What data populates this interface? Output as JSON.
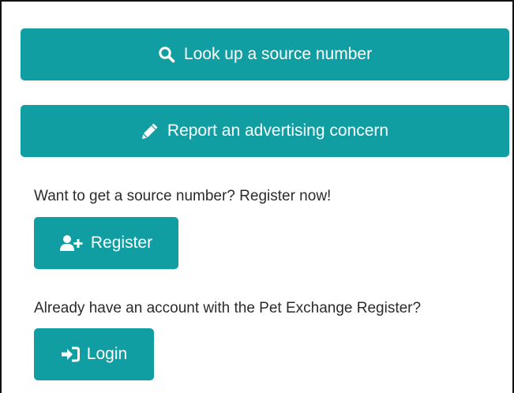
{
  "colors": {
    "button_bg": "#119ea3",
    "button_text": "#ffffff",
    "body_text": "#2b2b2b"
  },
  "actions": {
    "lookup": {
      "label": "Look up a source number",
      "icon": "search-icon"
    },
    "report": {
      "label": "Report an advertising concern",
      "icon": "pencil-icon"
    }
  },
  "register_section": {
    "prompt": "Want to get a source number? Register now!",
    "button_label": "Register",
    "icon": "user-plus-icon"
  },
  "login_section": {
    "prompt": "Already have an account with the Pet Exchange Register?",
    "button_label": "Login",
    "icon": "sign-in-icon"
  }
}
